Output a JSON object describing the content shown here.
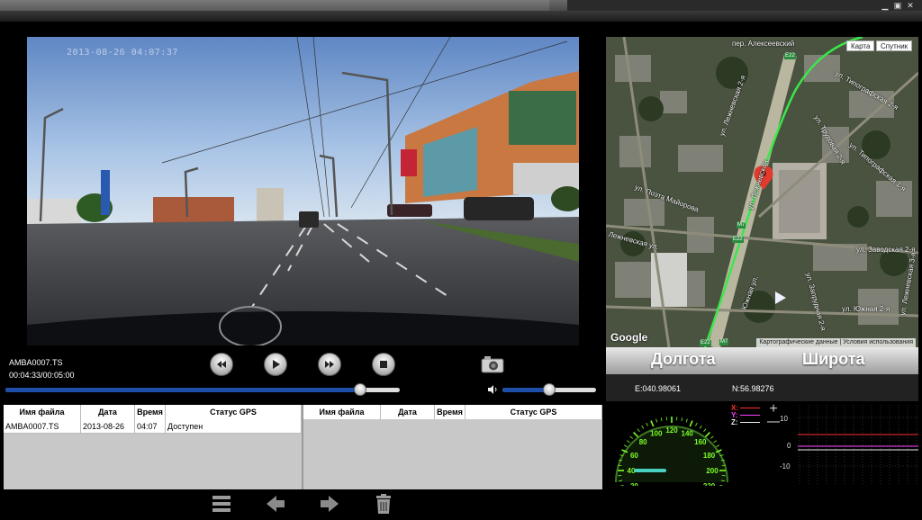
{
  "video": {
    "osd_timestamp": "2013-08-26 04:07:37",
    "filename": "AMBA0007.TS",
    "time_display": "00:04:33/00:05:00",
    "progress": 0.9,
    "volume": 0.5
  },
  "map": {
    "toggle_map": "Карта",
    "toggle_satellite": "Спутник",
    "labels": [
      "пер. Алексеевский",
      "ул. Лежневская 2-я",
      "ул. Типографская 2-я",
      "ул. Трудовая 2-я",
      "ул. Типографская 1-я",
      "ул. Поэта Майорова",
      "ул. Лежневская",
      "Лежневская ул.",
      "ул. Заводская 2-я",
      "ул. Южная 2-я",
      "Южная ул.",
      "ул. Запрудная 2-я",
      "ул. Лежневская 3-я"
    ],
    "signs": [
      "E22",
      "M7",
      "E22",
      "E22",
      "M7"
    ],
    "google": "Google",
    "copyright": "Картографические данные",
    "terms": "Условия использования"
  },
  "coords": {
    "lon_title": "Долгота",
    "lat_title": "Широта",
    "lon_value": "E:040.98061",
    "lat_value": "N:56.98276"
  },
  "table": {
    "headers": [
      "Имя файла",
      "Дата",
      "Время",
      "Статус GPS"
    ],
    "rows": [
      {
        "name": "AMBA0007.TS",
        "date": "2013-08-26",
        "time": "04:07",
        "status": "Доступен"
      }
    ]
  },
  "speedometer": {
    "ticks": [
      "0",
      "20",
      "40",
      "60",
      "80",
      "100",
      "120",
      "140",
      "160",
      "180",
      "200",
      "220",
      "240"
    ],
    "speed": 40,
    "max": 240,
    "color": "#7cff2a"
  },
  "accelerometer": {
    "legend": [
      "X:",
      "Y:",
      "Z:"
    ],
    "colors": [
      "#ff3030",
      "#ff40ff",
      "#f0f0f0"
    ],
    "plus": "+",
    "minus": "—",
    "y_ticks": [
      "10",
      "0",
      "-10"
    ],
    "ylim": [
      -15,
      15
    ]
  }
}
